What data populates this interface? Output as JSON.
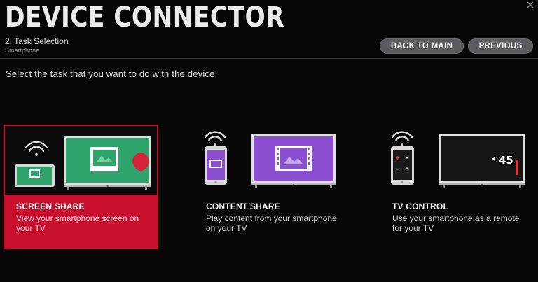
{
  "header": {
    "title": "DEVICE CONNECTOR",
    "step": "2. Task Selection",
    "device": "Smartphone",
    "back_label": "BACK TO MAIN",
    "previous_label": "PREVIOUS"
  },
  "prompt": "Select the task that you want to do with the device.",
  "options": [
    {
      "label": "SCREEN SHARE",
      "description": "View your smartphone screen on your TV",
      "icon": "screen-share-illustration",
      "selected": true
    },
    {
      "label": "CONTENT SHARE",
      "description": "Play content from your smartphone on your TV",
      "icon": "content-share-illustration",
      "selected": false
    },
    {
      "label": "TV CONTROL",
      "description": "Use your smartphone as a remote for your TV",
      "icon": "tv-control-illustration",
      "selected": false
    }
  ],
  "tv_control_volume": "45",
  "colors": {
    "accent": "#c8102e",
    "green": "#2ea36b",
    "purple": "#8c4fd1",
    "button": "#5b5b5e"
  }
}
